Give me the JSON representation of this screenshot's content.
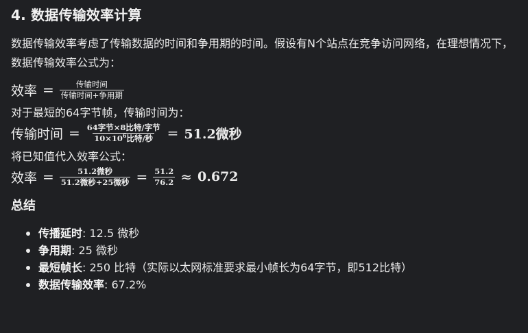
{
  "heading": "4. 数据传输效率计算",
  "intro": "数据传输效率考虑了传输数据的时间和争用期的时间。假设有N个站点在竞争访问网络，在理想情况下，数据传输效率公式为：",
  "eq1": {
    "lhs": "效率",
    "equals": "=",
    "num": "传输时间",
    "den": "传输时间+争用期"
  },
  "para2": "对于最短的64字节帧，传输时间为：",
  "eq2": {
    "lhs": "传输时间",
    "equals": "=",
    "num": "64字节×8比特/字节",
    "den_base": "10×10",
    "den_exp": "6",
    "den_unit": "比特/秒",
    "equals2": "=",
    "result": "51.2微秒"
  },
  "para3": "将已知值代入效率公式：",
  "eq3": {
    "lhs": "效率",
    "equals": "=",
    "num1": "51.2微秒",
    "den1": "51.2微秒+25微秒",
    "equals2": "=",
    "num2": "51.2",
    "den2": "76.2",
    "approx": "≈",
    "result": "0.672"
  },
  "summary_heading": "总结",
  "summary": [
    {
      "label": "传播延时",
      "value": ": 12.5 微秒"
    },
    {
      "label": "争用期",
      "value": ": 25 微秒"
    },
    {
      "label": "最短帧长",
      "value": ": 250 比特（实际以太网标准要求最小帧长为64字节，即512比特）"
    },
    {
      "label": "数据传输效率",
      "value": ": 67.2%"
    }
  ]
}
